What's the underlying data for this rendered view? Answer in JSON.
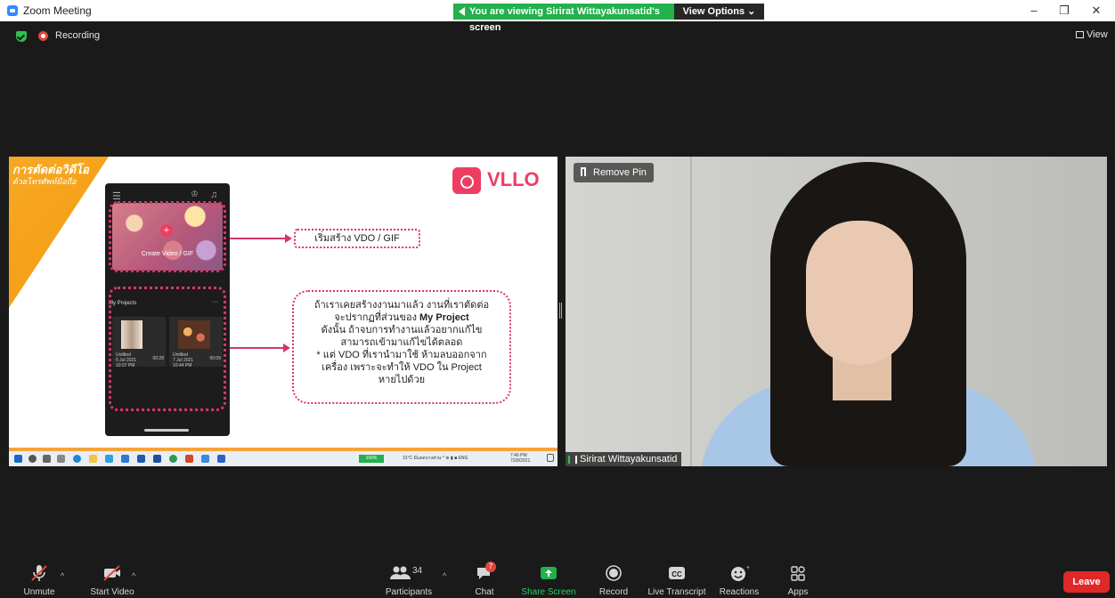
{
  "window": {
    "title": "Zoom Meeting",
    "minimize": "–",
    "maximize": "❐",
    "close": "✕"
  },
  "banner": {
    "text": "You are viewing Sirirat Wittayakunsatid's screen",
    "view_options": "View Options ⌄"
  },
  "status": {
    "recording": "Recording",
    "view": "View"
  },
  "shared_slide": {
    "topic_line1": "การตัดต่อวิดีโอ",
    "topic_line2": "ด้วยโทรศัพท์มือถือ",
    "brand": "VLLO",
    "phone": {
      "create_label": "Create Video / GIF",
      "my_projects": "My Projects",
      "more": "···",
      "projects": [
        {
          "title": "Untitled",
          "date": "6 Jul 2021",
          "time": "10:07 PM",
          "duration": "00:28"
        },
        {
          "title": "Untitled",
          "date": "7 Jul 2021",
          "time": "10:44 PM",
          "duration": "00:09"
        }
      ]
    },
    "label_start": "เริ่มสร้าง VDO / GIF",
    "info": {
      "line1": "ถ้าเราเคยสร้างงานมาแล้ว งานที่เราตัดต่อ",
      "line2_prefix": "จะปรากฏที่ส่วนของ ",
      "line2_bold": "My Project",
      "line3": "ดังนั้น ถ้าจบการทำงานแล้วอยากแก้ไข",
      "line4": "สามารถเข้ามาแก้ไขได้ตลอด",
      "line5": "* แต่ VDO ที่เรานำมาใช้ ห้ามลบออกจาก",
      "line6": "เครื่อง เพราะจะทำให้ VDO ใน Project",
      "line7": "หายไปด้วย"
    },
    "taskbar": {
      "battery": "100%",
      "weather": "31°C มีแดดบางส่วน",
      "tray": "^ ⊕ ▮ ■ ENG",
      "time": "7:46 PM",
      "date": "7/28/2021"
    }
  },
  "video": {
    "remove_pin": "Remove Pin",
    "participant_name": "Sirirat Wittayakunsatid"
  },
  "toolbar": {
    "unmute": "Unmute",
    "start_video": "Start Video",
    "participants": "Participants",
    "participants_count": "34",
    "chat": "Chat",
    "chat_badge": "7",
    "share_screen": "Share Screen",
    "record": "Record",
    "live_transcript": "Live Transcript",
    "reactions": "Reactions",
    "apps": "Apps",
    "leave": "Leave"
  },
  "colors": {
    "share_green": "#22b14c",
    "leave_red": "#e02828",
    "accent_pink": "#ee3d63",
    "dotted_magenta": "#d7346f",
    "orange": "#f39c12"
  }
}
